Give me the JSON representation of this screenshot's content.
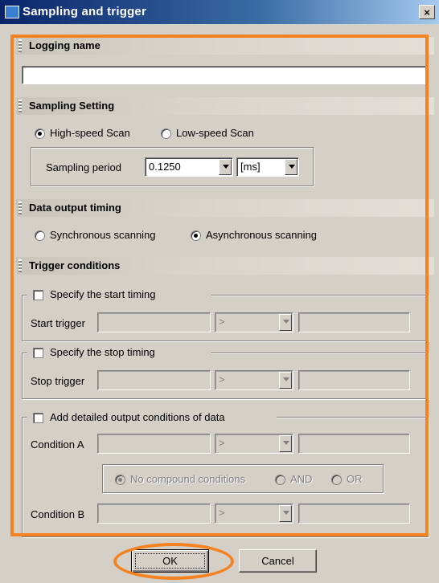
{
  "window": {
    "title": "Sampling and trigger",
    "close_glyph": "×",
    "icon": "app-window-icon"
  },
  "sections": {
    "logging": {
      "title": "Logging name",
      "input_value": ""
    },
    "sampling": {
      "title": "Sampling Setting",
      "options": [
        "High-speed Scan",
        "Low-speed Scan"
      ],
      "selected": "High-speed Scan",
      "period_label": "Sampling period",
      "period_value": "0.1250",
      "unit_value": "[ms]"
    },
    "output": {
      "title": "Data output timing",
      "options": [
        "Synchronous scanning",
        "Asynchronous scanning"
      ],
      "selected": "Asynchronous scanning"
    },
    "trigger": {
      "title": "Trigger conditions",
      "start": {
        "check_label": "Specify the start timing",
        "row_label": "Start trigger",
        "operator": ">"
      },
      "stop": {
        "check_label": "Specify the stop timing",
        "row_label": "Stop trigger",
        "operator": ">"
      },
      "detail": {
        "check_label": "Add detailed output conditions of data",
        "cond_a_label": "Condition A",
        "cond_b_label": "Condition B",
        "operator_a": ">",
        "operator_b": ">",
        "compound_options": [
          "No compound conditions",
          "AND",
          "OR"
        ],
        "compound_selected": "No compound conditions"
      }
    }
  },
  "buttons": {
    "ok": "OK",
    "cancel": "Cancel"
  },
  "colors": {
    "highlight": "#f58220",
    "title_bar": "#0a246a",
    "dialog_bg": "#d4d0c8"
  }
}
